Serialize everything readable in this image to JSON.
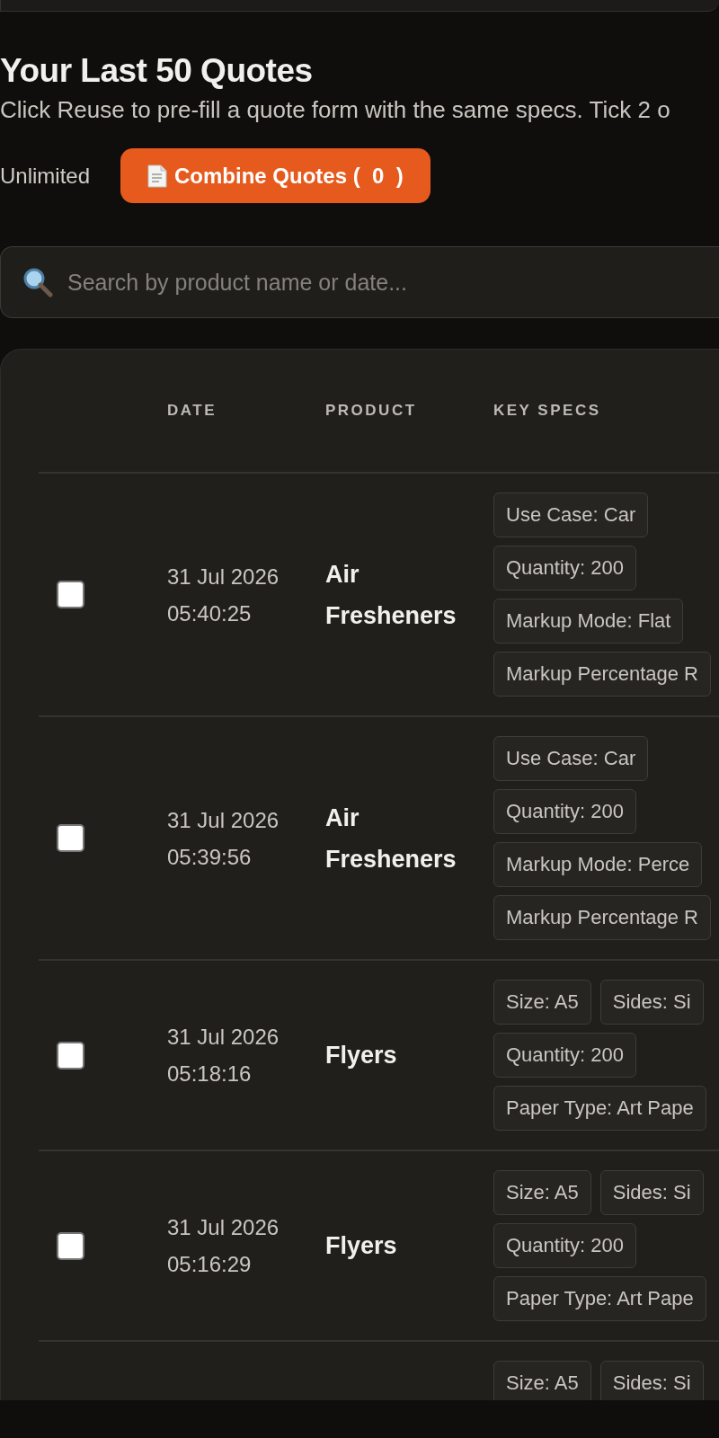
{
  "title": "Your Last 50 Quotes",
  "subtitle": "Click Reuse to pre-fill a quote form with the same specs. Tick 2 o",
  "plan_label": "Unlimited",
  "combine_button": {
    "label": "Combine Quotes (  0  )"
  },
  "search": {
    "placeholder": "Search by product name or date..."
  },
  "table": {
    "columns": [
      "DATE",
      "PRODUCT",
      "KEY SPECS"
    ],
    "rows": [
      {
        "checked": false,
        "date": "31 Jul 2026",
        "time": "05:40:25",
        "product": "Air Fresheners",
        "key_specs": [
          [
            "Use Case: Car"
          ],
          [
            "Quantity: 200"
          ],
          [
            "Markup Mode: Flat"
          ],
          [
            "Markup Percentage R"
          ]
        ]
      },
      {
        "checked": false,
        "date": "31 Jul 2026",
        "time": "05:39:56",
        "product": "Air Fresheners",
        "key_specs": [
          [
            "Use Case: Car"
          ],
          [
            "Quantity: 200"
          ],
          [
            "Markup Mode: Perce"
          ],
          [
            "Markup Percentage R"
          ]
        ]
      },
      {
        "checked": false,
        "date": "31 Jul 2026",
        "time": "05:18:16",
        "product": "Flyers",
        "key_specs": [
          [
            "Size: A5",
            "Sides: Si"
          ],
          [
            "Quantity: 200"
          ],
          [
            "Paper Type: Art Pape"
          ]
        ]
      },
      {
        "checked": false,
        "date": "31 Jul 2026",
        "time": "05:16:29",
        "product": "Flyers",
        "key_specs": [
          [
            "Size: A5",
            "Sides: Si"
          ],
          [
            "Quantity: 200"
          ],
          [
            "Paper Type: Art Pape"
          ]
        ]
      },
      {
        "key_specs": [
          [
            "Size: A5",
            "Sides: Si"
          ]
        ]
      }
    ]
  }
}
